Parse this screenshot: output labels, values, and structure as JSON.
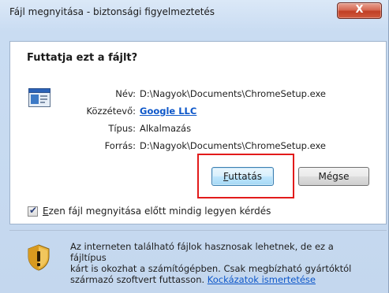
{
  "window": {
    "title": "Fájl megnyitása - biztonsági figyelmeztetés",
    "close_label": "X"
  },
  "dialog": {
    "heading": "Futtatja ezt a fájlt?",
    "fields": {
      "name_label": "Név:",
      "name_value": "D:\\Nagyok\\Documents\\ChromeSetup.exe",
      "publisher_label": "Közzétevő:",
      "publisher_value": "Google LLC",
      "type_label": "Típus:",
      "type_value": "Alkalmazás",
      "source_label": "Forrás:",
      "source_value": "D:\\Nagyok\\Documents\\ChromeSetup.exe"
    },
    "run_button_first": "F",
    "run_button_rest": "uttatás",
    "cancel_button": "Mégse",
    "checkbox_first": "E",
    "checkbox_rest": "zen fájl megnyitása előtt mindig legyen kérdés",
    "checkbox_checked": true
  },
  "warning": {
    "text_line1": "Az interneten található fájlok hasznosak lehetnek, de ez a fájltípus",
    "text_line2": "kárt is okozhat a számítógépben. Csak megbízható gyártóktól",
    "text_line3": "származó szoftvert futtasson.",
    "risk_link": "Kockázatok ismertetése"
  },
  "icons": {
    "file": "application-file-icon",
    "shield": "security-shield-icon",
    "close": "close-icon"
  },
  "colors": {
    "highlight": "#e21b1b",
    "link": "#0d57c9",
    "close_button": "#c13f25"
  }
}
